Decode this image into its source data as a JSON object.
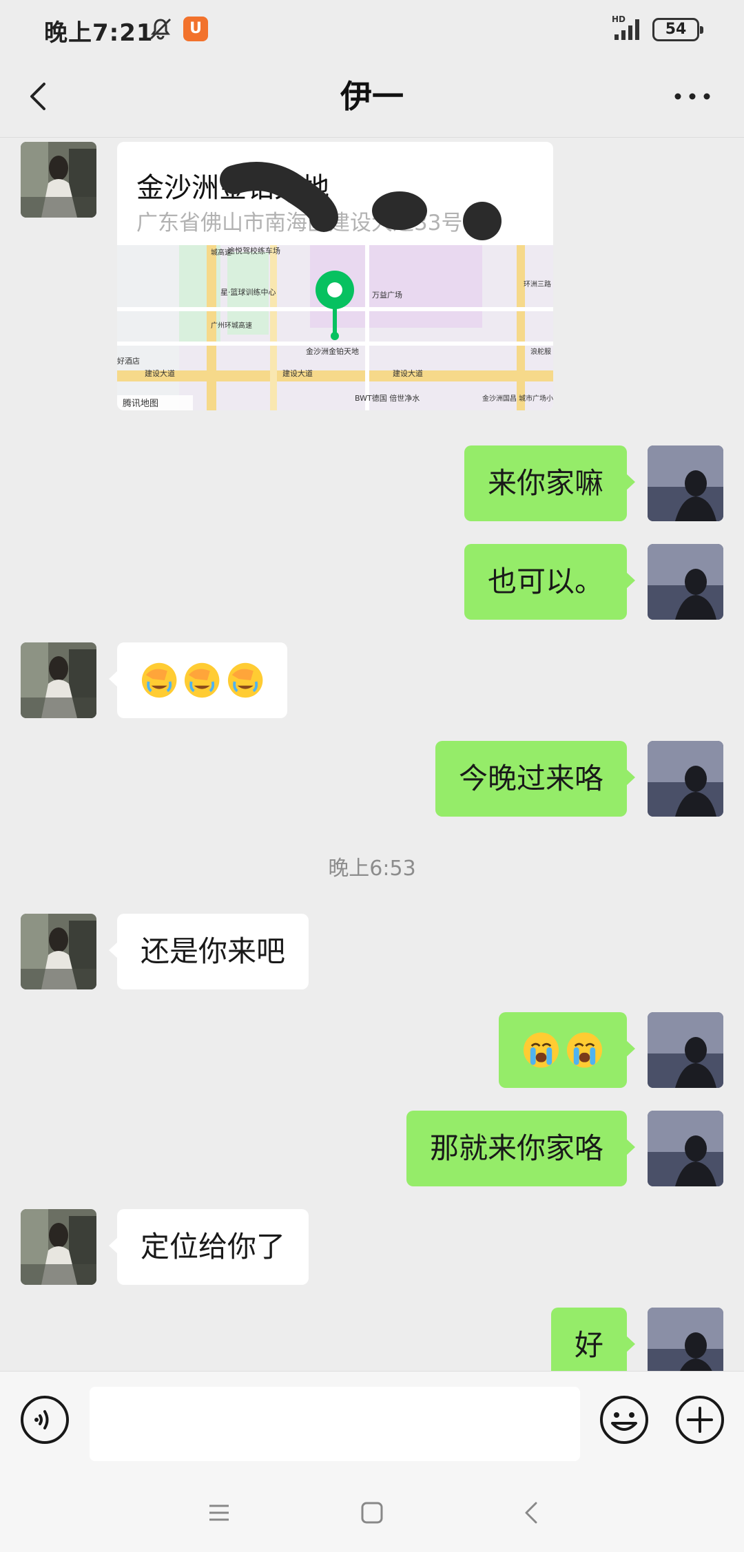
{
  "status_bar": {
    "time": "晚上7:21",
    "network": "HD",
    "battery": "54",
    "app_icon": "uc-browser-icon"
  },
  "nav": {
    "title": "伊一",
    "back_icon": "chevron-left-icon",
    "more_icon": "more-dots-icon"
  },
  "messages": [
    {
      "side": "left",
      "type": "location",
      "title": "金沙洲金铂天地",
      "address": "广东省佛山市南海区建设大道33号 栋",
      "map": {
        "provider": "腾讯地图",
        "pin_label": "金沙洲金铂天地",
        "labels": [
          "途悦驾校练车场",
          "星·篮球训练中心",
          "万益广场",
          "建设大道",
          "建设大道",
          "建设大道",
          "好酒店",
          "BWT德国 倍世净水",
          "金沙洲国昌 城市广场小",
          "浪舵服",
          "广州环城高速",
          "环洲三路",
          "城高速"
        ]
      }
    },
    {
      "side": "right",
      "type": "text",
      "text": "来你家嘛"
    },
    {
      "side": "right",
      "type": "text",
      "text": "也可以。"
    },
    {
      "side": "left",
      "type": "emoji",
      "emoji": [
        "facepalm-cry-emoji",
        "facepalm-cry-emoji",
        "facepalm-cry-emoji"
      ]
    },
    {
      "side": "right",
      "type": "text",
      "text": "今晚过来咯"
    },
    {
      "side": "center",
      "type": "timestamp",
      "text": "晚上6:53"
    },
    {
      "side": "left",
      "type": "text",
      "text": "还是你来吧"
    },
    {
      "side": "right",
      "type": "emoji",
      "emoji": [
        "sob-emoji",
        "sob-emoji"
      ]
    },
    {
      "side": "right",
      "type": "text",
      "text": "那就来你家咯"
    },
    {
      "side": "left",
      "type": "text",
      "text": "定位给你了"
    },
    {
      "side": "right",
      "type": "text",
      "text": "好"
    }
  ],
  "input": {
    "value": "",
    "placeholder": ""
  },
  "colors": {
    "background": "#ededed",
    "outgoing_bubble": "#95ec69",
    "incoming_bubble": "#ffffff",
    "map_pin": "#07c160"
  }
}
